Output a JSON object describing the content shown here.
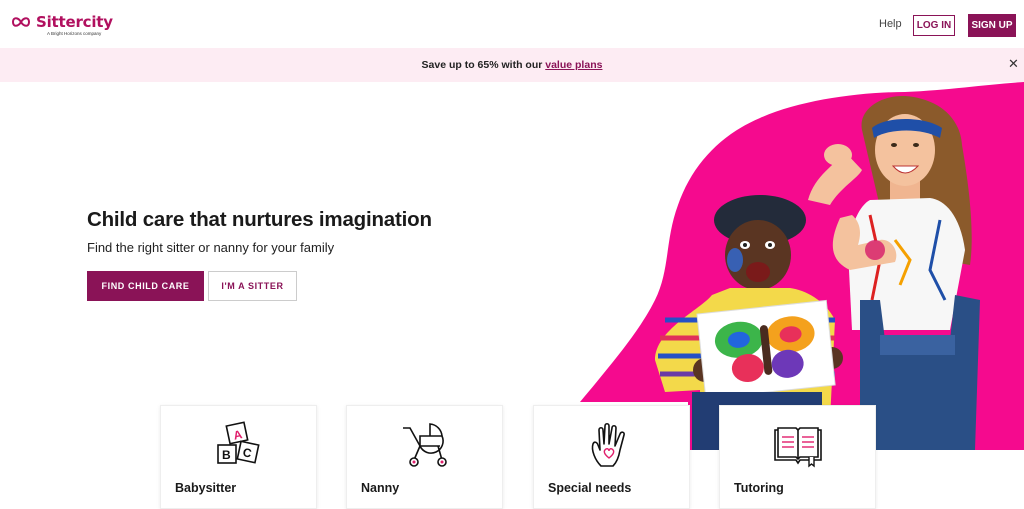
{
  "brand": {
    "name": "Sittercity",
    "tagline": "A Bright Horizons company",
    "accent": "#8a1357",
    "logo_color": "#b1105f",
    "hero_pink": "#f50a8e"
  },
  "nav": {
    "help": "Help",
    "login": "LOG IN",
    "signup": "SIGN UP"
  },
  "promo": {
    "text_before": "Save up to 65% with our ",
    "link_text": "value plans",
    "close_icon": "close-icon"
  },
  "hero": {
    "title": "Child care that nurtures imagination",
    "subtitle": "Find the right sitter or nanny for your family",
    "primary_button": "FIND CHILD CARE",
    "secondary_button": "I'M A SITTER"
  },
  "categories": [
    {
      "label": "Babysitter",
      "icon": "abc-blocks-icon"
    },
    {
      "label": "Nanny",
      "icon": "stroller-icon"
    },
    {
      "label": "Special needs",
      "icon": "hand-heart-icon"
    },
    {
      "label": "Tutoring",
      "icon": "open-book-icon"
    }
  ]
}
